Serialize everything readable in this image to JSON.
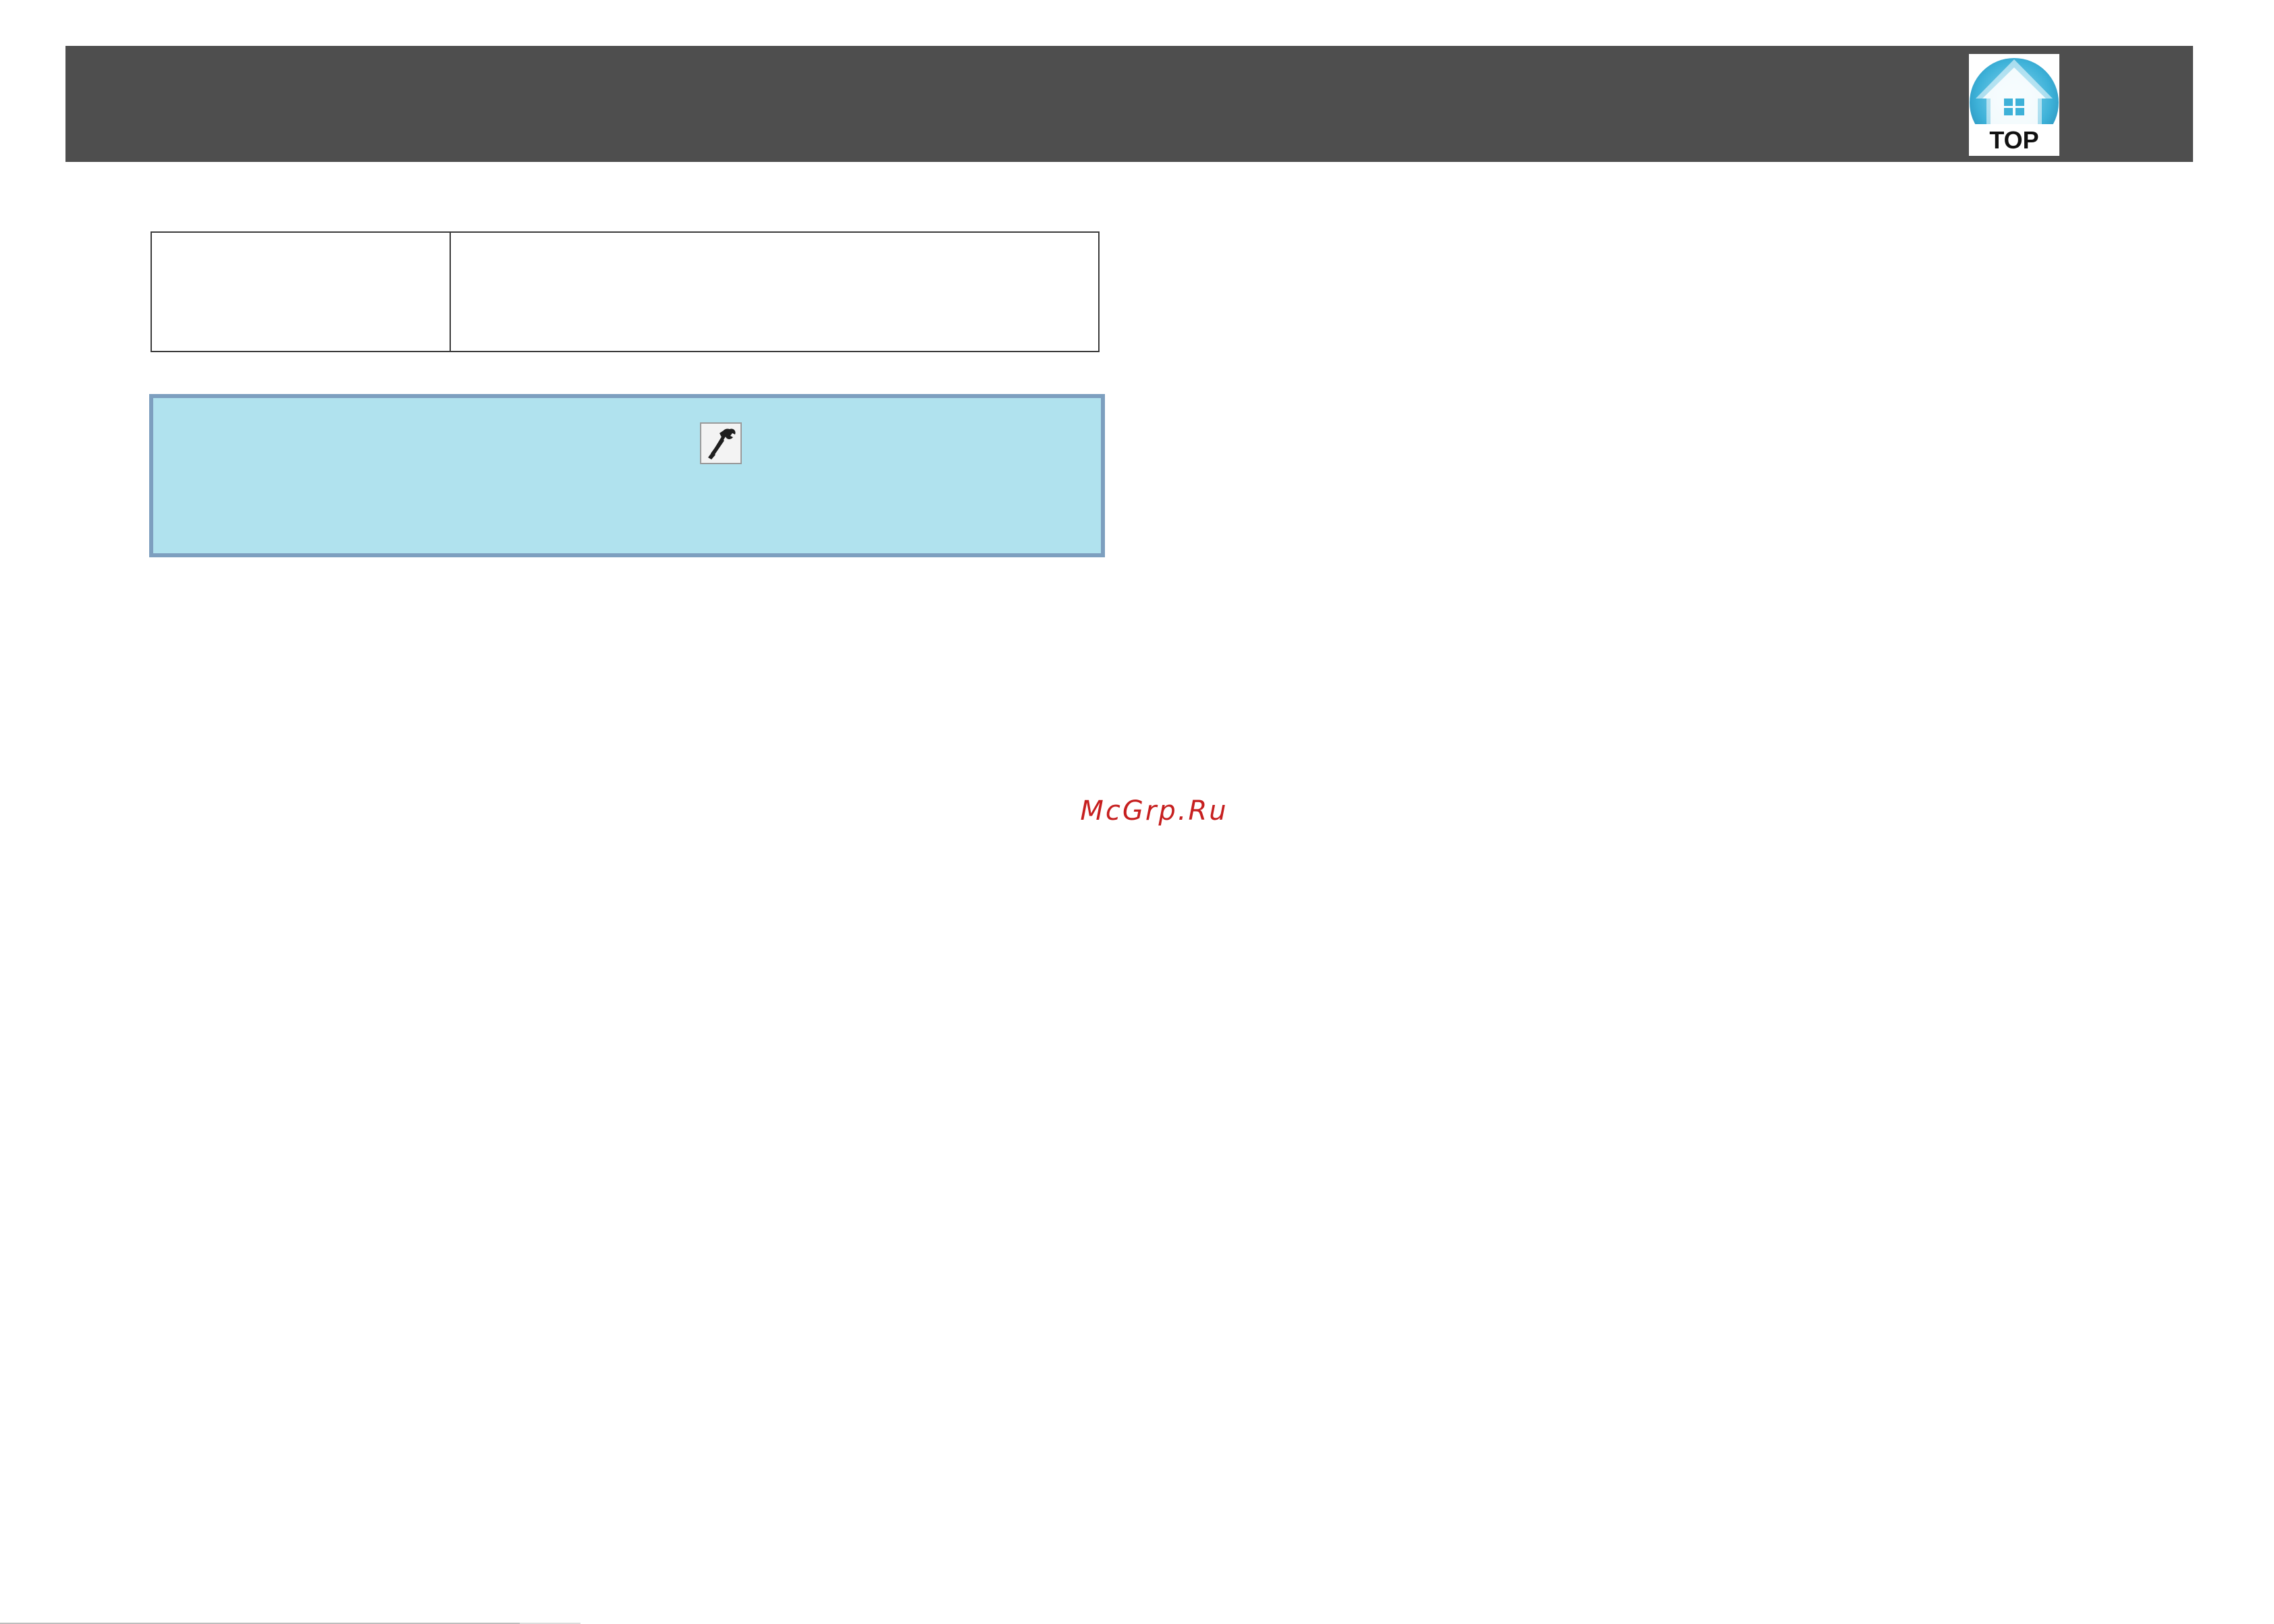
{
  "header": {
    "top_button": {
      "label": "TOP",
      "icon": "house-icon",
      "accent_color": "#3db1d8"
    }
  },
  "table": {
    "rows": [
      {
        "col_a": "",
        "col_b": ""
      }
    ]
  },
  "note": {
    "icon": "tools-icon",
    "background_color": "#b0e2ee",
    "border_color": "#7d9fbf"
  },
  "watermark": {
    "text": "McGrp.Ru",
    "color": "#c61f1f"
  },
  "colors": {
    "header_bar": "#4e4e4e"
  }
}
